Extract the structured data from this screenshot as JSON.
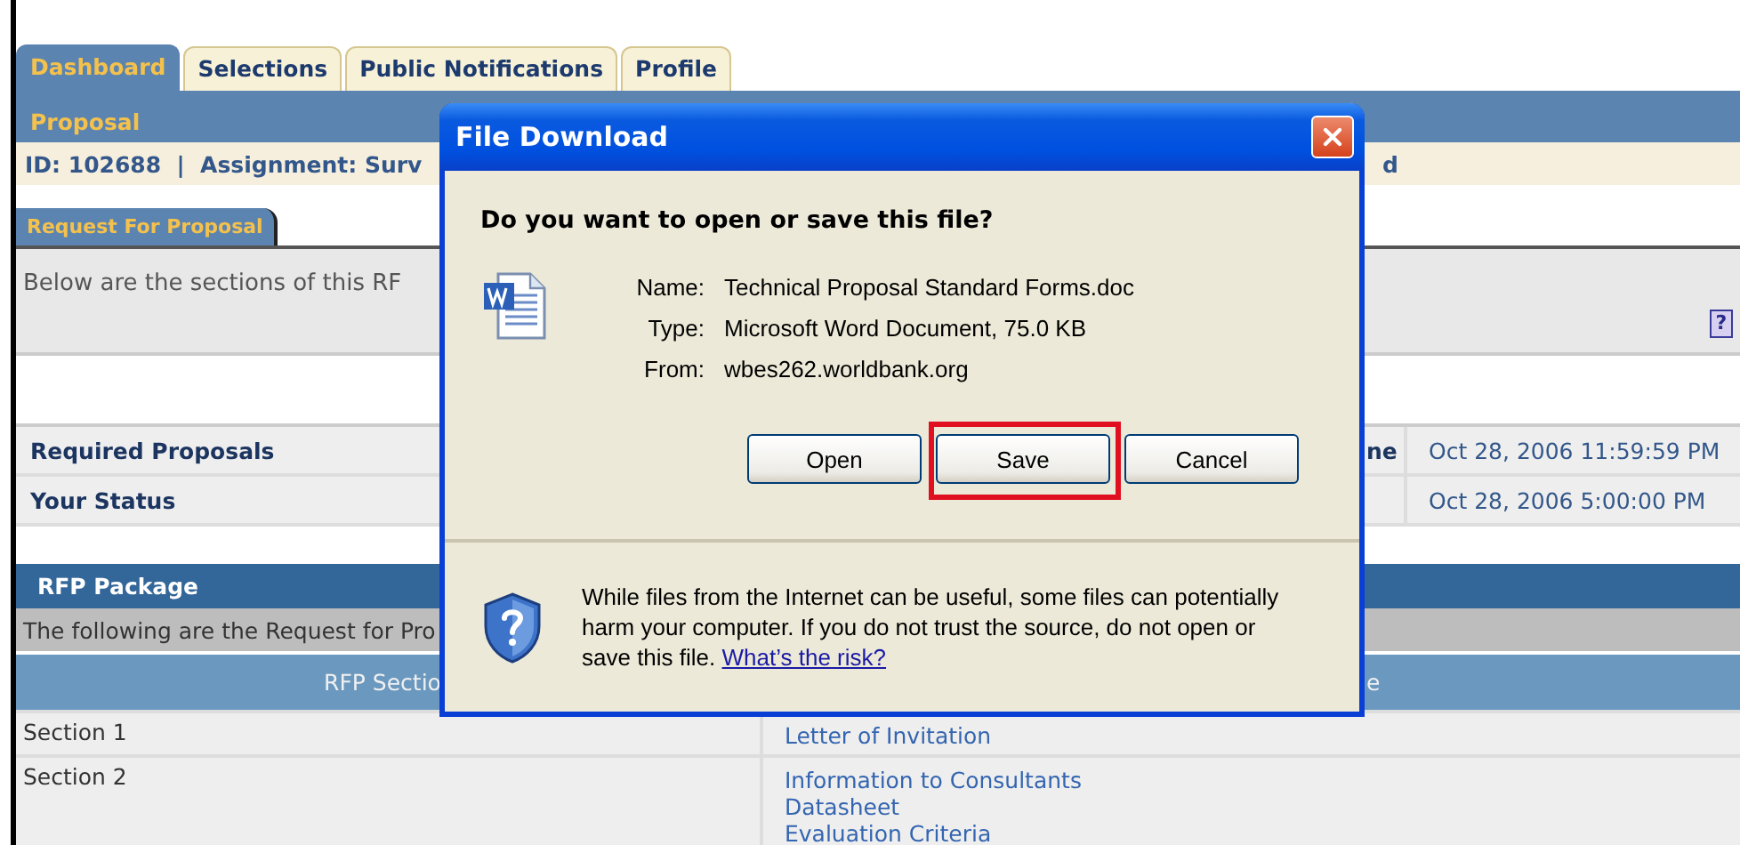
{
  "tabs": [
    {
      "label": "Dashboard",
      "selected": true
    },
    {
      "label": "Selections",
      "selected": false
    },
    {
      "label": "Public Notifications",
      "selected": false
    },
    {
      "label": "Profile",
      "selected": false
    }
  ],
  "proposal": {
    "title": "Proposal",
    "id_line": "ID: 102688  |  Assignment: Surv",
    "id_line_end": "d"
  },
  "subtabs": [
    {
      "label": "Request For Proposal",
      "selected": true
    }
  ],
  "intro": {
    "text": "Below are the sections of this RF",
    "help": "?"
  },
  "info_rows": [
    {
      "label": "Required Proposals",
      "column_2": "ne",
      "value": "Oct 28, 2006 11:59:59 PM"
    },
    {
      "label": "Your Status",
      "value": "Oct 28, 2006 5:00:00 PM"
    }
  ],
  "package": {
    "title": "RFP Package",
    "description": "The following are the Request for Pro",
    "columns": [
      "RFP Sectio",
      "e"
    ],
    "rows": [
      {
        "section": "Section 1",
        "documents": [
          "Letter of Invitation"
        ]
      },
      {
        "section": "Section 2",
        "documents": [
          "Information to Consultants",
          "Datasheet",
          "Evaluation Criteria"
        ]
      }
    ]
  },
  "dialog": {
    "title": "File Download",
    "question": "Do you want to open or save this file?",
    "details": [
      {
        "label": "Name:",
        "value": "Technical Proposal Standard Forms.doc"
      },
      {
        "label": "Type:",
        "value": "Microsoft Word Document, 75.0 KB"
      },
      {
        "label": "From:",
        "value": "wbes262.worldbank.org"
      }
    ],
    "buttons": [
      {
        "label": "Open",
        "highlighted": false
      },
      {
        "label": "Save",
        "highlighted": true
      },
      {
        "label": "Cancel",
        "highlighted": false
      }
    ],
    "warning": "While files from the Internet can be useful, some files can potentially harm your computer. If you do not trust the source, do not open or save this file.",
    "link": "What’s the risk?"
  }
}
